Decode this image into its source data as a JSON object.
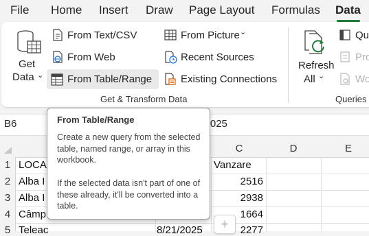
{
  "menu": {
    "tabs": [
      {
        "label": "File"
      },
      {
        "label": "Home"
      },
      {
        "label": "Insert"
      },
      {
        "label": "Draw"
      },
      {
        "label": "Page Layout"
      },
      {
        "label": "Formulas"
      },
      {
        "label": "Data",
        "active": true
      }
    ],
    "accent_color": "#1f7a3c"
  },
  "ribbon": {
    "get_data": {
      "line1": "Get",
      "line2": "Data"
    },
    "from_text_csv": "From Text/CSV",
    "from_web": "From Web",
    "from_table_range": "From Table/Range",
    "from_picture": "From Picture",
    "recent_sources": "Recent Sources",
    "existing_connections": "Existing Connections",
    "group_label": "Get & Transform Data",
    "refresh": {
      "line1": "Refresh",
      "line2": "All"
    },
    "queries_item1": "Qu",
    "queries_item2": "Pro",
    "queries_item3": "Wo",
    "queries_label": "Queries"
  },
  "formula_bar": {
    "name_box": "B6",
    "value_fragment": "5/2025"
  },
  "grid": {
    "columns": [
      "C",
      "D",
      "E"
    ],
    "rows": [
      "1",
      "2",
      "3",
      "4",
      "5"
    ],
    "cells": {
      "a1": "LOCA",
      "a2": "Alba I",
      "a3": "Alba I",
      "a4": "Câmp",
      "a5": "Teleac",
      "b5": "8/21/2025",
      "c1": "Vanzare",
      "c2": "2516",
      "c3": "2938",
      "c4": "1664",
      "c5": "2277"
    }
  },
  "tooltip": {
    "title": "From Table/Range",
    "para1": "Create a new query from the selected table, named range, or array in this workbook.",
    "para2": "If the selected data isn't part of one of these already, it'll be converted into a table."
  }
}
